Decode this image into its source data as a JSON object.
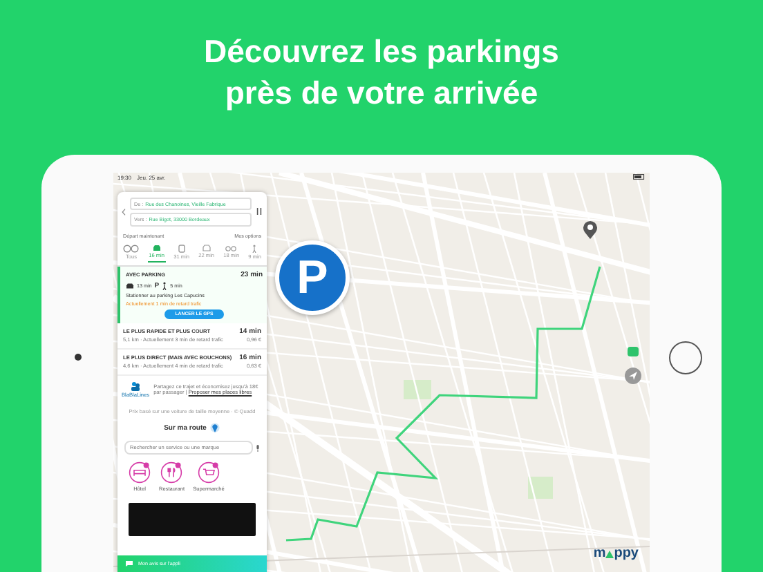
{
  "headline": [
    "Découvrez les parkings",
    "près de votre arrivée"
  ],
  "status_bar": {
    "time": "19:30",
    "date": "Jeu. 25 avr."
  },
  "route_form": {
    "from_label": "De :",
    "from": "Rue des Chanoines, Vieille Fabrique",
    "to_label": "Vers :",
    "to": "Rue Bigot, 33000 Bordeaux"
  },
  "options": {
    "departure": "Départ maintenant",
    "my_options": "Mes options"
  },
  "modes": [
    {
      "kind": "all",
      "label": "Tous",
      "selected": false
    },
    {
      "kind": "car",
      "label": "16 min",
      "selected": true
    },
    {
      "kind": "transit",
      "label": "31 min",
      "selected": false
    },
    {
      "kind": "taxi",
      "label": "22 min",
      "selected": false
    },
    {
      "kind": "bike",
      "label": "18 min",
      "selected": false
    },
    {
      "kind": "walk",
      "label": "9 min",
      "selected": false
    }
  ],
  "featured_route": {
    "title": "AVEC PARKING",
    "duration": "23 min",
    "drive": "13 min",
    "parking": "P",
    "walk": "5 min",
    "description": "Stationner au parking Les Capucins",
    "traffic": "Actuellement 1 min de retard trafic",
    "button": "LANCER LE GPS"
  },
  "routes": [
    {
      "title": "LE PLUS RAPIDE ET PLUS COURT",
      "duration": "14 min",
      "details": "5,1 km · Actuellement 3 min de retard trafic",
      "cost": "0,96 €"
    },
    {
      "title": "LE PLUS DIRECT (MAIS AVEC BOUCHONS)",
      "duration": "16 min",
      "details": "4,6 km · Actuellement 4 min de retard trafic",
      "cost": "0,63 €"
    }
  ],
  "carpool": {
    "brand": "BlaBlaLines",
    "text": "Partagez ce trajet et économisez jusqu'à 18€ par passager |",
    "link": "Proposer mes places libres"
  },
  "footnote": "Prix basé sur une voiture de taille moyenne · © Quadd",
  "on_my_route": {
    "title": "Sur ma route",
    "search_placeholder": "Rechercher un service ou une marque",
    "categories": [
      {
        "kind": "hotel",
        "label": "Hôtel"
      },
      {
        "kind": "restaurant",
        "label": "Restaurant"
      },
      {
        "kind": "supermarket",
        "label": "Supermarché"
      }
    ]
  },
  "feedback": "Mon avis sur l'appli",
  "map": {
    "parking_marker": "P",
    "logo_start": "m",
    "logo_end": "ppy"
  }
}
